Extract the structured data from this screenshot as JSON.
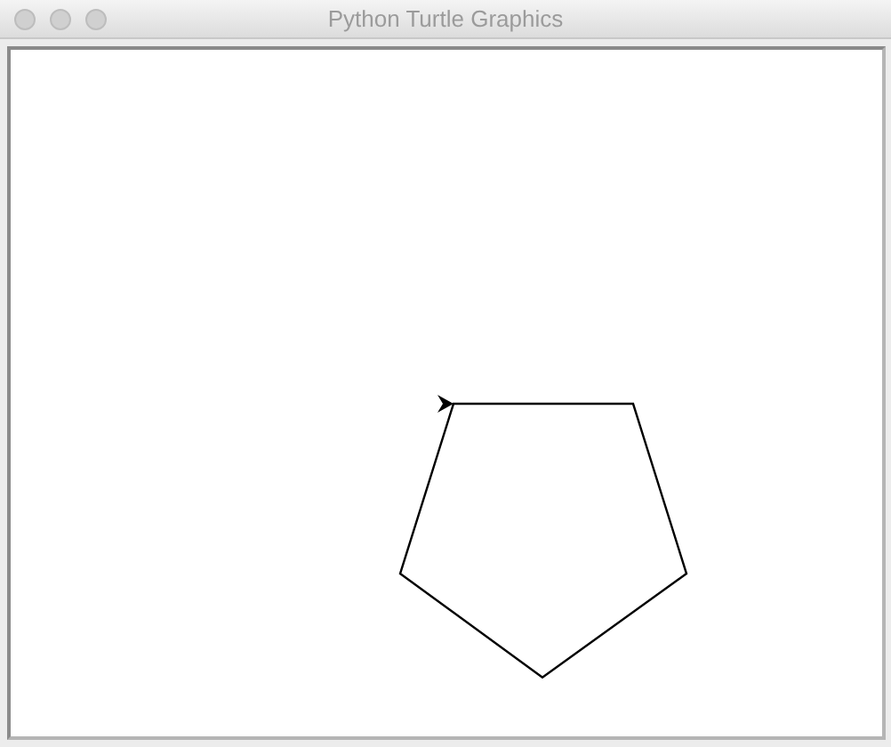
{
  "window": {
    "title": "Python Turtle Graphics"
  }
}
